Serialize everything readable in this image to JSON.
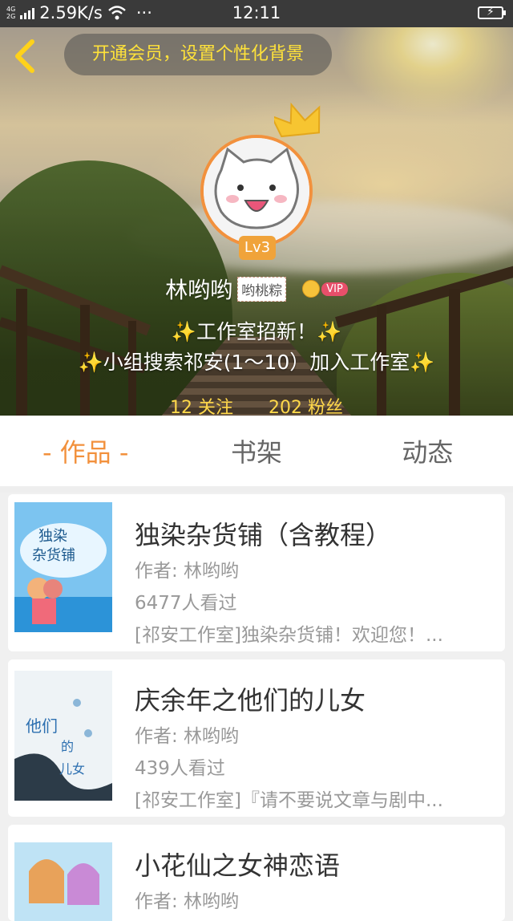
{
  "status_bar": {
    "network": [
      "4G",
      "2G"
    ],
    "speed": "2.59K/s",
    "more": "···",
    "time": "12:11"
  },
  "header": {
    "promo": "开通会员，设置个性化背景",
    "level": "Lv3",
    "username": "林哟哟",
    "tag": "哟桃粽",
    "vip": "VIP",
    "bio_line1": "✨工作室招新！✨",
    "bio_line2": "✨小组搜索祁安(1～10）加入工作室✨",
    "follow": "12 关注",
    "fans": "202 粉丝"
  },
  "tabs": [
    {
      "label": "- 作品 -",
      "active": true
    },
    {
      "label": "书架",
      "active": false
    },
    {
      "label": "动态",
      "active": false
    }
  ],
  "works": [
    {
      "title": "独染杂货铺（含教程）",
      "author": "作者: 林哟哟",
      "views": "6477人看过",
      "desc": "[祁安工作室]独染杂货铺！欢迎您！..."
    },
    {
      "title": "庆余年之他们的儿女",
      "author": "作者: 林哟哟",
      "views": "439人看过",
      "desc": "[祁安工作室]『请不要说文章与剧中..."
    },
    {
      "title": "小花仙之女神恋语",
      "author": "作者: 林哟哟",
      "views": "",
      "desc": ""
    }
  ],
  "colors": {
    "accent": "#f2913d",
    "promo_text": "#ffe23a",
    "stats_text": "#ffd84a"
  }
}
